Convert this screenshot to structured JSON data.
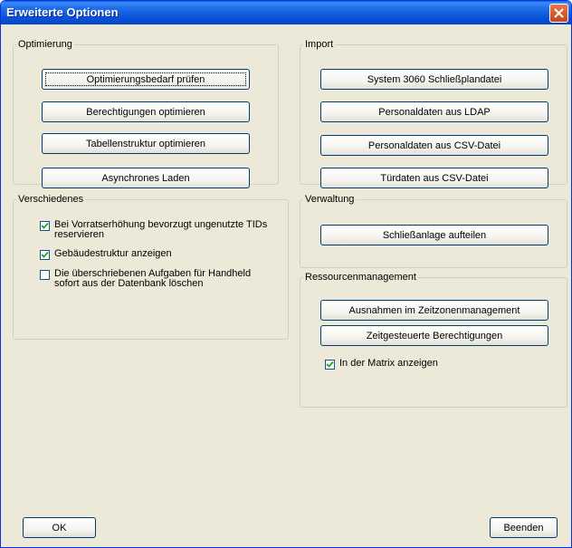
{
  "window": {
    "title": "Erweiterte Optionen"
  },
  "optimierung": {
    "legend": "Optimierung",
    "buttons": [
      "Optimierungsbedarf prüfen",
      "Berechtigungen optimieren",
      "Tabellenstruktur optimieren",
      "Asynchrones Laden"
    ]
  },
  "import": {
    "legend": "Import",
    "buttons": [
      "System 3060 Schließplandatei",
      "Personaldaten aus LDAP",
      "Personaldaten aus CSV-Datei",
      "Türdaten aus CSV-Datei"
    ]
  },
  "verschiedenes": {
    "legend": "Verschiedenes",
    "checks": [
      {
        "label": "Bei Vorratserhöhung bevorzugt ungenutzte TIDs reservieren",
        "checked": true
      },
      {
        "label": "Gebäudestruktur anzeigen",
        "checked": true
      },
      {
        "label": "Die überschriebenen Aufgaben für Handheld sofort aus der Datenbank löschen",
        "checked": false
      }
    ]
  },
  "verwaltung": {
    "legend": "Verwaltung",
    "button": "Schließanlage aufteilen"
  },
  "ressourcen": {
    "legend": "Ressourcenmanagement",
    "buttons": [
      "Ausnahmen im Zeitzonenmanagement",
      "Zeitgesteuerte Berechtigungen"
    ],
    "check": {
      "label": "In der Matrix anzeigen",
      "checked": true
    }
  },
  "footer": {
    "ok": "OK",
    "close": "Beenden"
  }
}
